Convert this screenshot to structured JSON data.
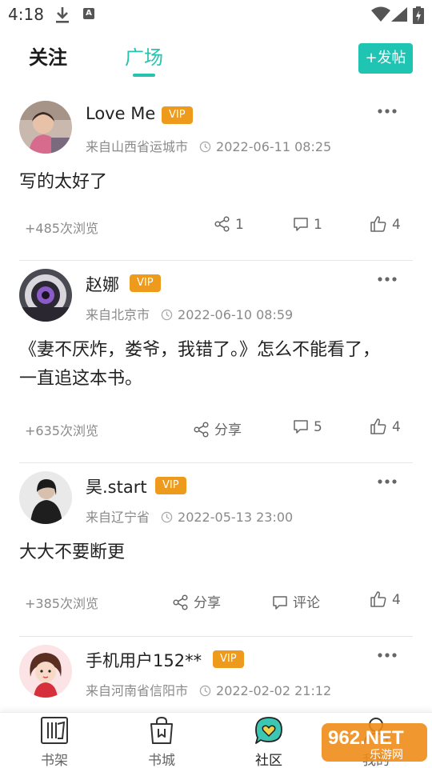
{
  "status_bar": {
    "time": "4:18",
    "letter_icon": "A"
  },
  "top_nav": {
    "tabs": [
      {
        "label": "关注",
        "active": false
      },
      {
        "label": "广场",
        "active": true
      }
    ],
    "post_button_label": "+发帖",
    "accent_color": "#29c2b0"
  },
  "posts": [
    {
      "username": "Love Me",
      "badge": "VIP",
      "location": "来自山西省运城市",
      "time": "2022-06-11 08:25",
      "content": "写的太好了",
      "views": "+485次浏览",
      "share": "1",
      "comments": "1",
      "likes": "4",
      "avatar_icon": "girl-photo"
    },
    {
      "username": "赵娜",
      "badge": "VIP",
      "location": "来自北京市",
      "time": "2022-06-10 08:59",
      "content": "《妻不厌炸，娄爷，我错了。》怎么不能看了，一直追这本书。",
      "views": "+635次浏览",
      "share": "分享",
      "comments": "5",
      "likes": "4",
      "avatar_icon": "eye-photo"
    },
    {
      "username": "昊.start",
      "badge": "VIP",
      "location": "来自辽宁省",
      "time": "2022-05-13 23:00",
      "content": "大大不要断更",
      "views": "+385次浏览",
      "share": "分享",
      "comments": "评论",
      "likes": "4",
      "avatar_icon": "person-photo"
    },
    {
      "username": "手机用户152**",
      "badge": "VIP",
      "location": "来自河南省信阳市",
      "time": "2022-02-02 21:12",
      "avatar_icon": "cartoon-girl"
    }
  ],
  "bottom_nav": [
    {
      "label": "书架",
      "icon": "bookshelf-icon",
      "active": false
    },
    {
      "label": "书城",
      "icon": "bookstore-bag-icon",
      "active": false
    },
    {
      "label": "社区",
      "icon": "community-chat-heart-icon",
      "active": true
    },
    {
      "label": "我的",
      "icon": "profile-icon",
      "active": false
    }
  ],
  "watermark": {
    "text": "962.NET",
    "subtext": "乐游网"
  },
  "colors": {
    "accent": "#29c2b0",
    "vip": "#ee9a1c",
    "meta_text": "#8a8a8a"
  }
}
